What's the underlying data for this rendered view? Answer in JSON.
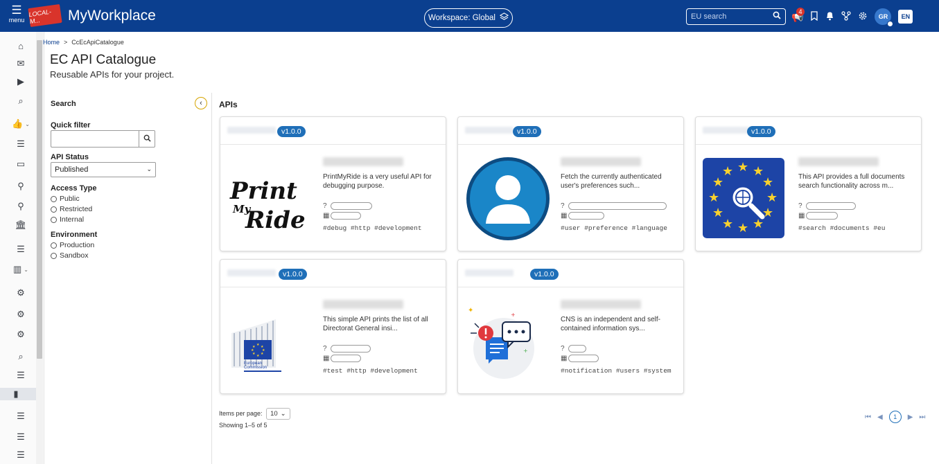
{
  "topbar": {
    "menu_label": "menu",
    "env_badge": "LOCAL-M...",
    "app_title": "MyWorkplace",
    "workspace": "Workspace: Global",
    "search_placeholder": "EU search",
    "notification_count": "4",
    "avatar": "GR",
    "language": "EN",
    "colors": {
      "bar": "#0b3f8f",
      "badge": "#d9342b"
    }
  },
  "rail": {
    "icons": [
      "home-icon",
      "mail-icon",
      "play-icon",
      "search-icon",
      "thumbs-up-icon",
      "list-icon",
      "folder-icon",
      "sitemap-icon",
      "map-pin-icon",
      "bank-icon",
      "list-icon",
      "chart-icon",
      "cogs-icon",
      "cogs-icon",
      "cogs-icon",
      "search-icon",
      "list-icon",
      "document-icon",
      "list-icon",
      "list-icon",
      "list-icon"
    ]
  },
  "breadcrumb": {
    "home": "Home",
    "separator": ">",
    "current": "CcEcApiCatalogue"
  },
  "page": {
    "title": "EC API Catalogue",
    "subtitle": "Reusable APIs for your project."
  },
  "filters": {
    "heading": "Search",
    "quick_filter_label": "Quick filter",
    "quick_filter_value": "",
    "api_status_label": "API Status",
    "api_status_value": "Published",
    "access_type_label": "Access Type",
    "access_types": [
      "Public",
      "Restricted",
      "Internal"
    ],
    "environment_label": "Environment",
    "environments": [
      "Production",
      "Sandbox"
    ]
  },
  "apis": {
    "heading": "APIs",
    "cards": [
      {
        "version": "v1.0.0",
        "description": "PrintMyRide is a very useful API for debugging purpose.",
        "tags": "#debug  #http  #development",
        "image": "printmyride-logo"
      },
      {
        "version": "v1.0.0",
        "description": "Fetch the currently authenticated user's preferences such...",
        "tags": "#user  #preference  #language",
        "image": "user-profile-icon"
      },
      {
        "version": "v1.0.0",
        "description": "This API provides a full documents search functionality across m...",
        "tags": "#search  #documents  #eu",
        "image": "eu-search-icon"
      },
      {
        "version": "v1.0.0",
        "description": "This simple API prints the list of all Directorat General insi...",
        "tags": "#test  #http  #development",
        "image": "european-commission-logo"
      },
      {
        "version": "v1.0.0",
        "description": "CNS is an independent and self-contained information sys...",
        "tags": "#notification  #users  #system",
        "image": "notifications-illustration"
      }
    ]
  },
  "pagination": {
    "items_per_page_label": "Items per page:",
    "items_per_page": "10",
    "showing": "Showing 1–5 of 5",
    "current_page": "1"
  },
  "printmyride_logo": {
    "line1": "Print",
    "line2": "My",
    "line3": "Ride"
  },
  "ec_logo": {
    "line1": "European",
    "line2": "Commission"
  }
}
